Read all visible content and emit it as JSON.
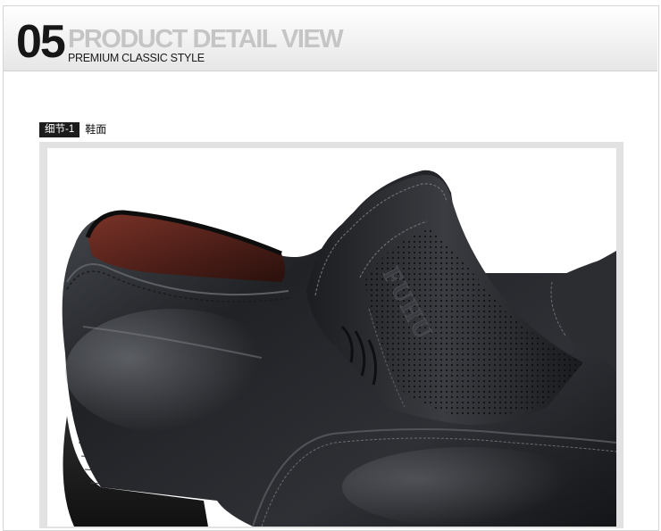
{
  "header": {
    "number": "05",
    "title": "PRODUCT DETAIL VIEW",
    "subtitle": "PREMIUM CLASSIC STYLE"
  },
  "detail": {
    "tag": "细节-1",
    "label": "鞋面"
  },
  "photo": {
    "emboss_text": "FUHU"
  }
}
